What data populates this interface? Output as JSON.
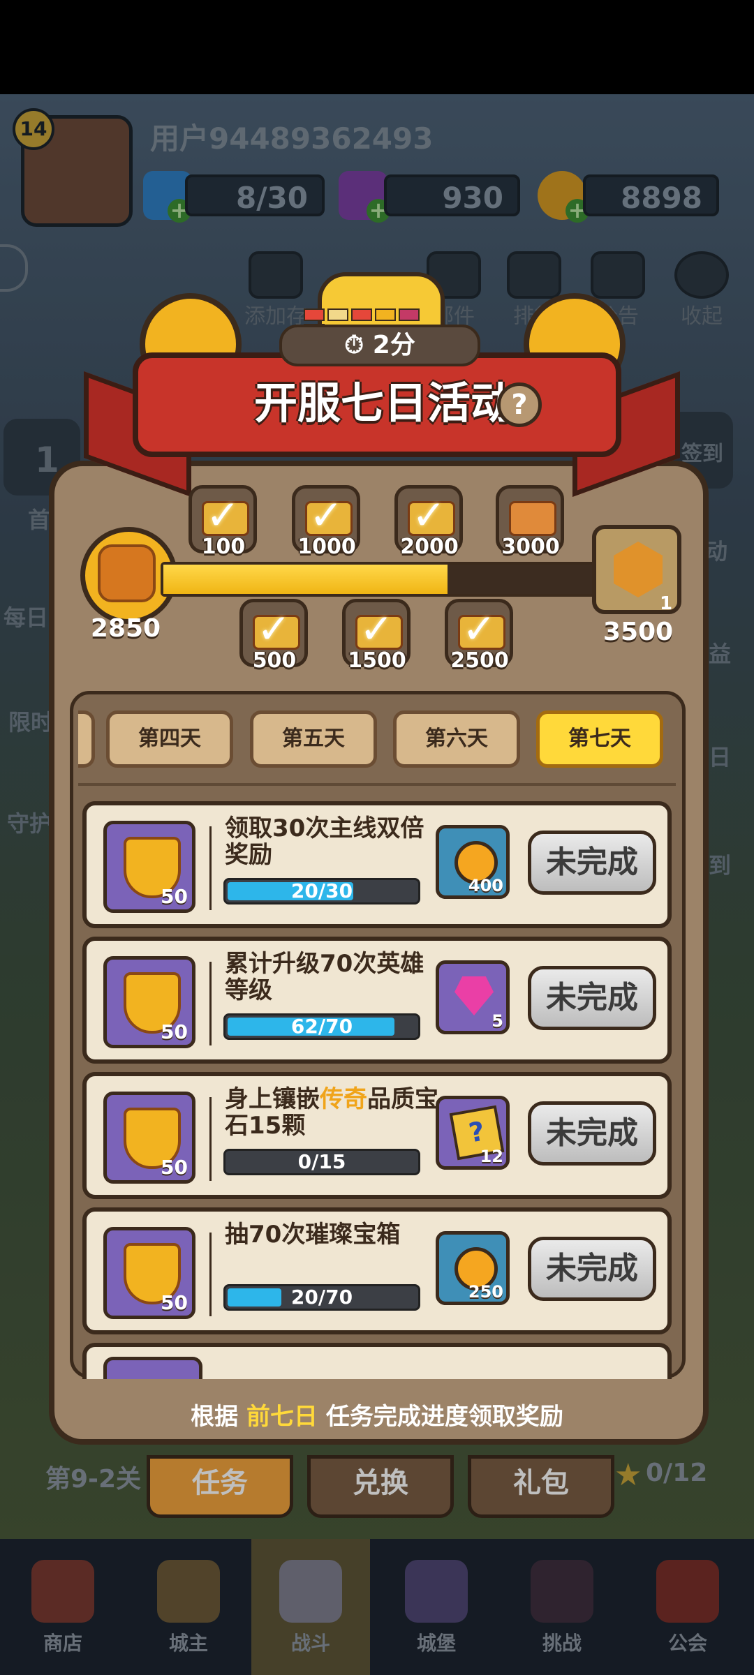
{
  "hud": {
    "level": "14",
    "username": "用户94489362493",
    "energy": "8/30",
    "gems": "930",
    "coins": "8898"
  },
  "top_icons": [
    "添加存",
    "邮件",
    "排行",
    "公告",
    "收起"
  ],
  "side_icons_left": [
    "1",
    "首",
    "每日",
    "限时",
    "守护"
  ],
  "side_icons_right": [
    "签到",
    "动",
    "益",
    "日",
    "到"
  ],
  "event": {
    "timer": "2分",
    "title": "开服七日活动",
    "help": "?",
    "progress": {
      "start_value": "2850",
      "end_value": "3500",
      "end_count": "1",
      "current": 2850,
      "max": 3500,
      "milestones_top": [
        "100",
        "1000",
        "2000",
        "3000"
      ],
      "milestones_bottom": [
        "500",
        "1500",
        "2500"
      ]
    },
    "day_tabs": [
      "第四天",
      "第五天",
      "第六天",
      "第七天"
    ],
    "active_day": "第七天",
    "tasks": [
      {
        "desc": "领取30次主线双倍奖励",
        "reward_left": "50",
        "progress_text": "20/30",
        "progress": 0.667,
        "reward_count": "400",
        "reward_type": "gold-coin",
        "reward_bg": "#3f8fb7",
        "status": "未完成"
      },
      {
        "desc": "累计升级70次英雄等级",
        "reward_left": "50",
        "progress_text": "62/70",
        "progress": 0.886,
        "reward_count": "5",
        "reward_type": "pink-gem",
        "reward_bg": "#7b63b8",
        "status": "未完成"
      },
      {
        "desc_pre": "身上镶嵌",
        "desc_hl": "传奇",
        "desc_post": "品质宝石15颗",
        "reward_left": "50",
        "progress_text": "0/15",
        "progress": 0,
        "reward_count": "12",
        "reward_type": "puzzle",
        "reward_bg": "#7b63b8",
        "status": "未完成"
      },
      {
        "desc": "抽70次璀璨宝箱",
        "reward_left": "50",
        "progress_text": "20/70",
        "progress": 0.286,
        "reward_count": "250",
        "reward_type": "gold-coin",
        "reward_bg": "#3f8fb7",
        "status": "未完成"
      }
    ],
    "footer_pre": "根据",
    "footer_hl": "前七日",
    "footer_post": "任务完成进度领取奖励"
  },
  "stage": "第9-2关",
  "stars": "0/12",
  "sub_tabs": [
    "任务",
    "兑换",
    "礼包"
  ],
  "bottom_nav": [
    "商店",
    "城主",
    "战斗",
    "城堡",
    "挑战",
    "公会"
  ],
  "colors": {
    "accent_gold": "#ffd93a",
    "progress_blue": "#2db6ea",
    "banner_red": "#c8342a",
    "panel_brown": "#9c8368"
  }
}
